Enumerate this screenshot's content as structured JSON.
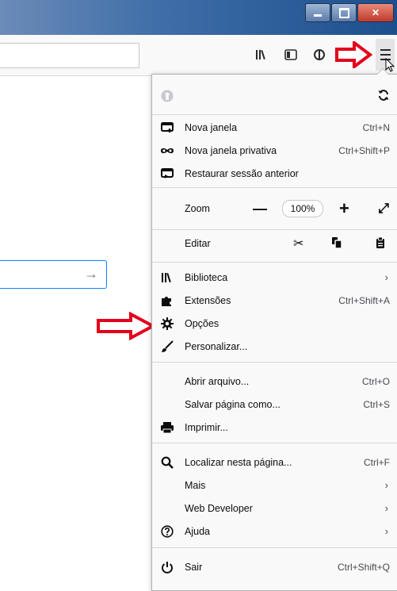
{
  "toolbar": {
    "icons": [
      "library-icon",
      "sidebar-icon",
      "extension-icon",
      "pocket-icon",
      "menu-icon"
    ]
  },
  "menu": {
    "account": {
      "icon": "user-icon",
      "sync_icon": "sync-icon"
    },
    "new_window": {
      "label": "Nova janela",
      "shortcut": "Ctrl+N"
    },
    "private_window": {
      "label": "Nova janela privativa",
      "shortcut": "Ctrl+Shift+P"
    },
    "restore_session": {
      "label": "Restaurar sessão anterior"
    },
    "zoom": {
      "label": "Zoom",
      "minus": "—",
      "value": "100%",
      "plus": "+",
      "fullscreen": "⤢"
    },
    "edit": {
      "label": "Editar"
    },
    "library": {
      "label": "Biblioteca",
      "chevron": "›"
    },
    "addons": {
      "label": "Extensões",
      "shortcut": "Ctrl+Shift+A"
    },
    "options": {
      "label": "Opções"
    },
    "customize": {
      "label": "Personalizar..."
    },
    "open_file": {
      "label": "Abrir arquivo...",
      "shortcut": "Ctrl+O"
    },
    "save_page": {
      "label": "Salvar página como...",
      "shortcut": "Ctrl+S"
    },
    "print": {
      "label": "Imprimir..."
    },
    "find": {
      "label": "Localizar nesta página...",
      "shortcut": "Ctrl+F"
    },
    "more": {
      "label": "Mais",
      "chevron": "›"
    },
    "web_developer": {
      "label": "Web Developer",
      "chevron": "›"
    },
    "help": {
      "label": "Ajuda",
      "chevron": "›"
    },
    "quit": {
      "label": "Sair",
      "shortcut": "Ctrl+Shift+Q"
    }
  },
  "page": {
    "search_arrow": "→"
  },
  "colors": {
    "highlight_arrow": "#e3001b",
    "accent": "#0a84ff"
  }
}
